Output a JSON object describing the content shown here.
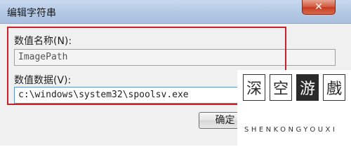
{
  "dialog": {
    "title": "编辑字符串",
    "close_glyph": "✕",
    "value_name_label": "数值名称(N):",
    "value_name": "ImagePath",
    "value_data_label": "数值数据(V):",
    "value_data": "c:\\windows\\system32\\spoolsv.exe",
    "ok_label": "确定"
  },
  "watermark": {
    "chars": [
      "深",
      "空",
      "游",
      "戲"
    ],
    "text": "SHENKONGYOUXI"
  },
  "colors": {
    "highlight": "#c82128",
    "titlebar": "#b3c8e4"
  }
}
